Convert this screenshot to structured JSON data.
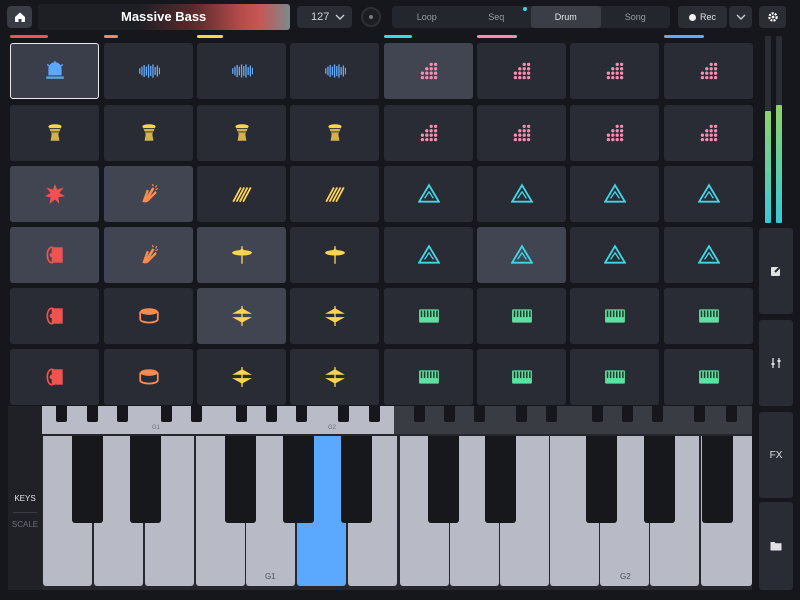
{
  "header": {
    "home_icon": "home-icon",
    "title": "Massive Bass",
    "tempo": "127",
    "tabs": [
      {
        "label": "Loop",
        "active": false
      },
      {
        "label": "Seq",
        "active": false
      },
      {
        "label": "Drum",
        "active": true
      },
      {
        "label": "Song",
        "active": false
      }
    ],
    "rec_label": "Rec",
    "settings_icon": "gear-icon"
  },
  "column_colors": [
    "#ef5350",
    "#ff8a50",
    "#ffd54f",
    "#40d6e6",
    "#f48fb1",
    "#64a9f5"
  ],
  "pads": {
    "rows": [
      [
        "siren-icon",
        "waveform-icon",
        "waveform-icon",
        "waveform-icon",
        "dots-icon",
        "dots-icon",
        "dots-icon",
        "dots-icon"
      ],
      [
        "djembe-icon",
        "djembe-icon",
        "djembe-icon",
        "djembe-icon",
        "dots-icon",
        "dots-icon",
        "dots-icon",
        "dots-icon"
      ],
      [
        "splash-icon",
        "clap-icon",
        "shaker-icon",
        "shaker-icon",
        "triangle-icon",
        "triangle-icon",
        "triangle-icon",
        "triangle-icon"
      ],
      [
        "kick-drum-icon",
        "clap-icon",
        "cymbal-icon",
        "cymbal-icon",
        "triangle-icon",
        "triangle-icon",
        "triangle-icon",
        "triangle-icon"
      ],
      [
        "kick-drum-icon",
        "snare-icon",
        "hihat-icon",
        "hihat-icon",
        "keyboard-icon",
        "keyboard-icon",
        "keyboard-icon",
        "keyboard-icon"
      ],
      [
        "kick-drum-icon",
        "snare-icon",
        "hihat-icon",
        "hihat-icon",
        "keyboard-icon",
        "keyboard-icon",
        "keyboard-icon",
        "keyboard-icon"
      ]
    ]
  },
  "sidebar": {
    "edit_icon": "edit-icon",
    "mixer_icon": "sliders-icon",
    "fx_label": "FX",
    "folder_icon": "folder-icon"
  },
  "keyboard": {
    "mode_keys": "KEYS",
    "mode_scale": "SCALE",
    "mini_labels": [
      "G1",
      "G2"
    ],
    "key_labels": [
      "G1",
      "G2"
    ]
  }
}
